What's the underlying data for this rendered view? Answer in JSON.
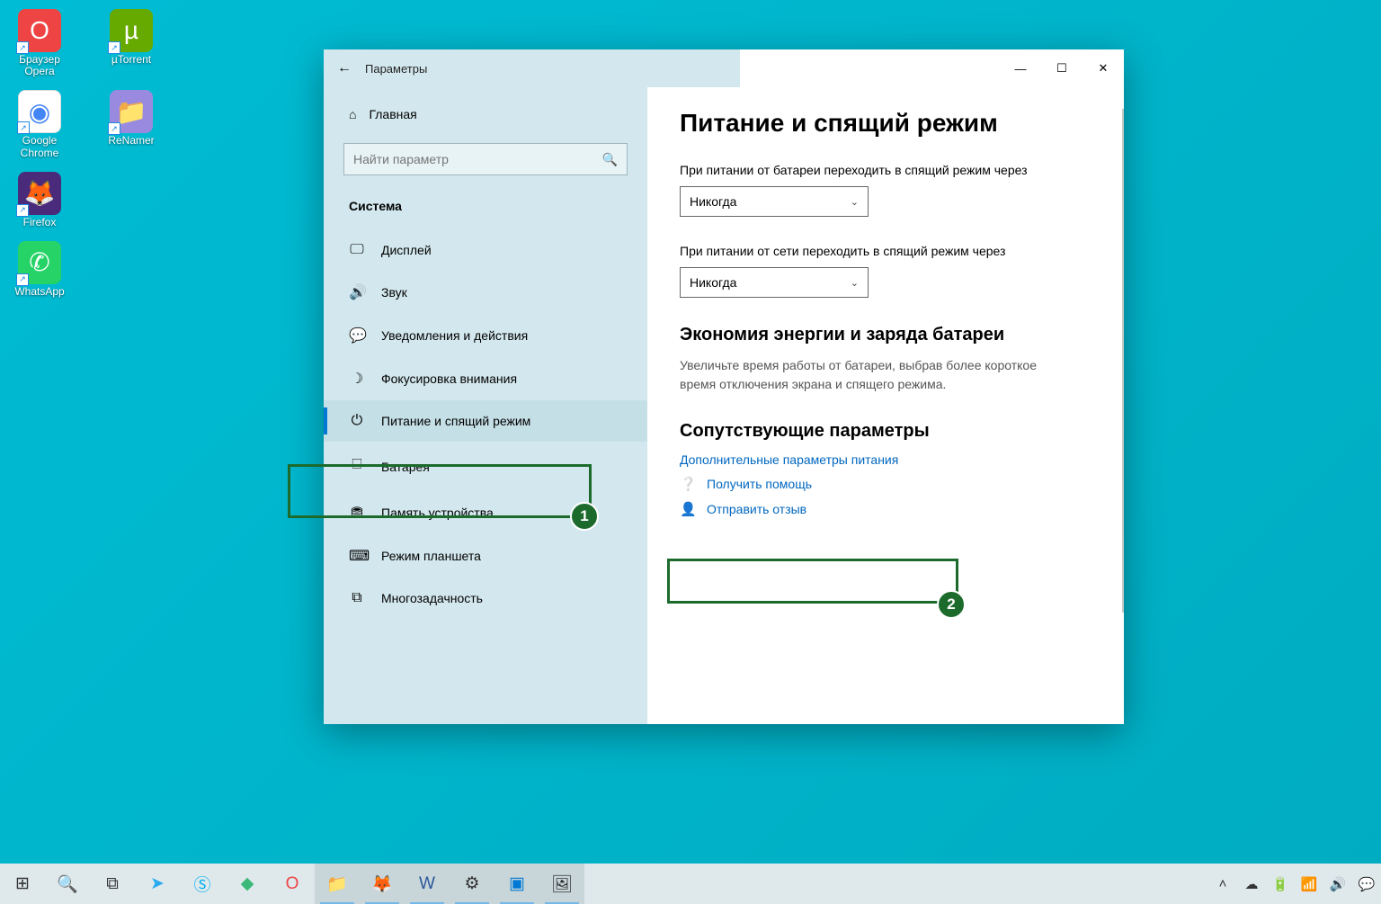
{
  "desktop": {
    "icons": [
      {
        "label": "Браузер Opera",
        "glyph": "O",
        "bg": "#e44"
      },
      {
        "label": "µTorrent",
        "glyph": "µ",
        "bg": "#6a0"
      },
      {
        "label": "Google Chrome",
        "glyph": "◐",
        "bg": "#fff"
      },
      {
        "label": "ReNamer",
        "glyph": "📁",
        "bg": "#9a8adf"
      },
      {
        "label": "Firefox",
        "glyph": "🦊",
        "bg": "#4a2a7a"
      },
      {
        "label": "WhatsApp",
        "glyph": "✆",
        "bg": "#25d366"
      }
    ]
  },
  "window": {
    "title": "Параметры",
    "home": "Главная",
    "search_placeholder": "Найти параметр",
    "section": "Система",
    "nav": [
      {
        "icon": "▭",
        "label": "Дисплей"
      },
      {
        "icon": "🔊",
        "label": "Звук"
      },
      {
        "icon": "💬",
        "label": "Уведомления и действия"
      },
      {
        "icon": "☽",
        "label": "Фокусировка внимания"
      },
      {
        "icon": "⏻",
        "label": "Питание и спящий режим",
        "active": true
      },
      {
        "icon": "▭",
        "label": "Батарея"
      },
      {
        "icon": "⛃",
        "label": "Память устройства"
      },
      {
        "icon": "⌨",
        "label": "Режим планшета"
      },
      {
        "icon": "⧉",
        "label": "Многозадачность"
      }
    ]
  },
  "content": {
    "heading": "Питание и спящий режим",
    "battery_label": "При питании от батареи переходить в спящий режим через",
    "battery_value": "Никогда",
    "ac_label": "При питании от сети переходить в спящий режим через",
    "ac_value": "Никогда",
    "energy_heading": "Экономия энергии и заряда батареи",
    "energy_desc": "Увеличьте время работы от батареи, выбрав более короткое время отключения экрана и спящего режима.",
    "related_heading": "Сопутствующие параметры",
    "related_link": "Дополнительные параметры питания",
    "help_link": "Получить помощь",
    "feedback_link": "Отправить отзыв"
  },
  "annotations": {
    "one": "1",
    "two": "2"
  }
}
